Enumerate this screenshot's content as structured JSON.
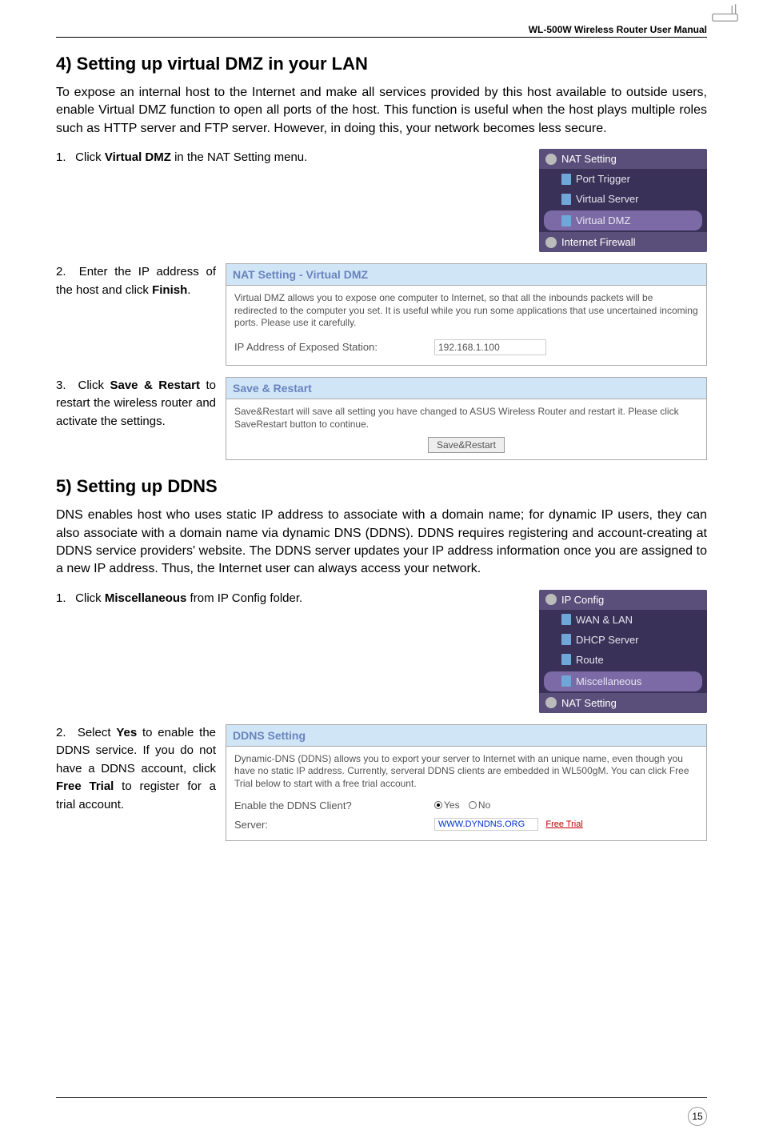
{
  "header": {
    "title": "WL-500W Wireless Router User Manual"
  },
  "section4": {
    "heading": "4) Setting up virtual DMZ in your LAN",
    "intro": "To expose an internal host to the Internet and make all services provided by this host available to outside users, enable Virtual DMZ function to open all ports of the host. This function is useful when the host plays multiple roles such as HTTP server and FTP server. However, in doing this, your network becomes less secure.",
    "steps": {
      "s1": {
        "num": "1.",
        "t1": "Click ",
        "b1": "Virtual DMZ",
        "t2": " in the NAT Setting menu."
      },
      "s2": {
        "num": "2.",
        "t1": "Enter the IP address of the host and click ",
        "b1": "Finish",
        "t2": "."
      },
      "s3": {
        "num": "3.",
        "t1": "Click ",
        "b1": "Save & Restart",
        "t2": " to restart the wireless router and activate the settings."
      }
    },
    "nav": {
      "h1": "NAT Setting",
      "i1": "Port Trigger",
      "i2": "Virtual Server",
      "i3": "Virtual DMZ",
      "h2": "Internet Firewall"
    },
    "dmzbox": {
      "title": "NAT Setting - Virtual DMZ",
      "desc": "Virtual DMZ allows you to expose one computer to Internet, so that all the inbounds packets will be redirected to the computer you set. It is useful while you run some applications that use uncertained incoming ports. Please use it carefully.",
      "label": "IP Address of Exposed Station:",
      "value": "192.168.1.100"
    },
    "savebox": {
      "title": "Save & Restart",
      "desc": "Save&Restart will save all setting you have changed to ASUS Wireless Router and restart it. Please click SaveRestart button to continue.",
      "btn": "Save&Restart"
    }
  },
  "section5": {
    "heading": "5) Setting up DDNS",
    "intro": "DNS enables host who uses static IP address to associate with a domain name; for dynamic IP users, they can also associate with a domain name via dynamic DNS (DDNS). DDNS requires registering and account-creating at DDNS service providers' website. The DDNS server updates your IP address information once you are assigned to a new IP address. Thus, the Internet user can always access your network.",
    "steps": {
      "s1": {
        "num": "1.",
        "t1": "Click ",
        "b1": "Miscellaneous",
        "t2": " from IP Config folder."
      },
      "s2": {
        "num": "2.",
        "t1": "Select ",
        "b1": "Yes",
        "t2": " to enable the DDNS service. If you do not have a DDNS account, click ",
        "b2": "Free Trial",
        "t3": " to register for a trial account."
      }
    },
    "nav": {
      "h1": "IP Config",
      "i1": "WAN & LAN",
      "i2": "DHCP Server",
      "i3": "Route",
      "i4": "Miscellaneous",
      "h2": "NAT Setting"
    },
    "ddnsbox": {
      "title": "DDNS Setting",
      "desc": "Dynamic-DNS (DDNS) allows you to export your server to Internet with an unique name, even though you have no static IP address. Currently, serveral DDNS clients are embedded in WL500gM. You can click Free Trial below to start with a free trial account.",
      "label1": "Enable the DDNS Client?",
      "opt_yes": "Yes",
      "opt_no": "No",
      "label2": "Server:",
      "server": "WWW.DYNDNS.ORG",
      "link": "Free Trial"
    }
  },
  "page_number": "15"
}
